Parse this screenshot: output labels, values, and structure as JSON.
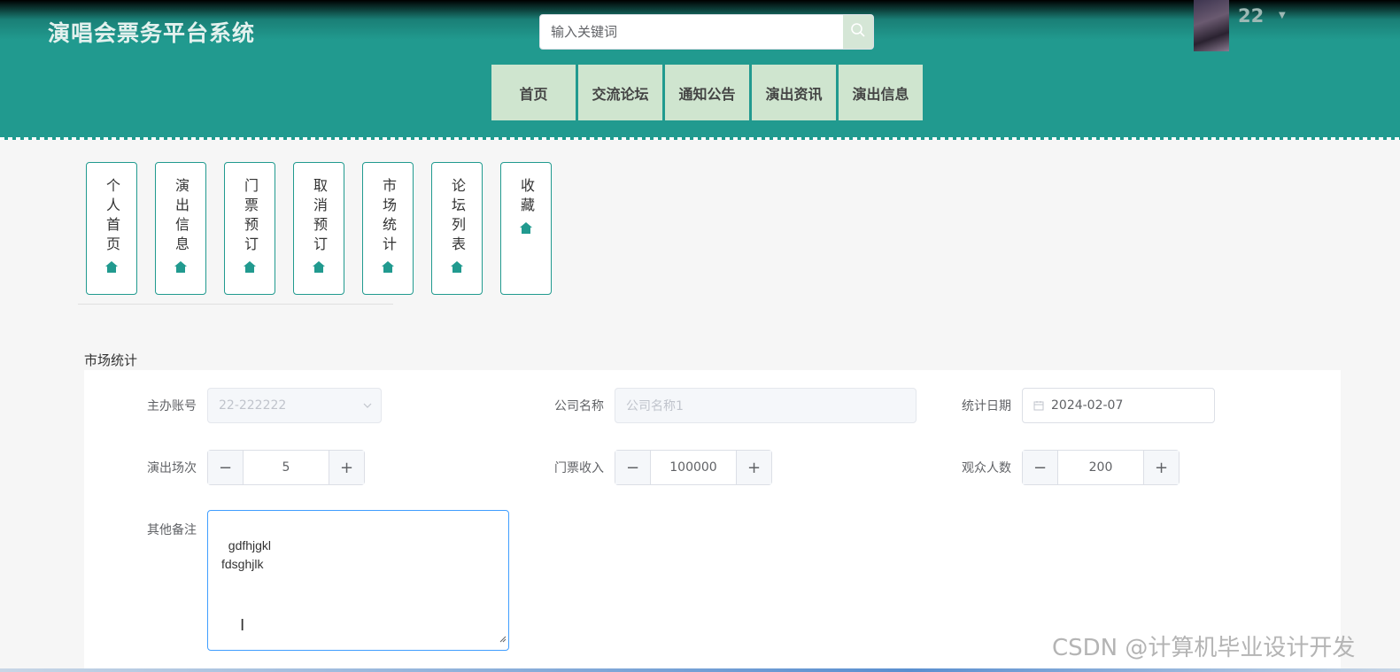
{
  "header": {
    "site_title": "演唱会票务平台系统",
    "search": {
      "placeholder": "输入关键词",
      "icon": "search-icon"
    },
    "user": {
      "name": "22",
      "dropdown_icon": "caret-down-icon"
    },
    "nav": [
      {
        "label": "首页"
      },
      {
        "label": "交流论坛"
      },
      {
        "label": "通知公告"
      },
      {
        "label": "演出资讯"
      },
      {
        "label": "演出信息"
      }
    ]
  },
  "side_menu": {
    "icon": "home-icon",
    "items": [
      {
        "label": "个人首页"
      },
      {
        "label": "演出信息"
      },
      {
        "label": "门票预订"
      },
      {
        "label": "取消预订"
      },
      {
        "label": "市场统计"
      },
      {
        "label": "论坛列表"
      },
      {
        "label": "收藏"
      }
    ]
  },
  "form": {
    "section_title": "市场统计",
    "organizer_account": {
      "label": "主办账号",
      "value": "22-222222"
    },
    "company_name": {
      "label": "公司名称",
      "placeholder": "公司名称1"
    },
    "stat_date": {
      "label": "统计日期",
      "value": "2024-02-07"
    },
    "show_count": {
      "label": "演出场次",
      "value": "5"
    },
    "ticket_revenue": {
      "label": "门票收入",
      "value": "100000"
    },
    "audience_count": {
      "label": "观众人数",
      "value": "200"
    },
    "remarks": {
      "label": "其他备注",
      "value": "gdfhjgkl\nfdsghjlk"
    }
  },
  "watermark": "CSDN @计算机毕业设计开发",
  "colors": {
    "primary": "#219a8f",
    "nav_bg": "#cfe5cf",
    "focus_border": "#409eff"
  }
}
